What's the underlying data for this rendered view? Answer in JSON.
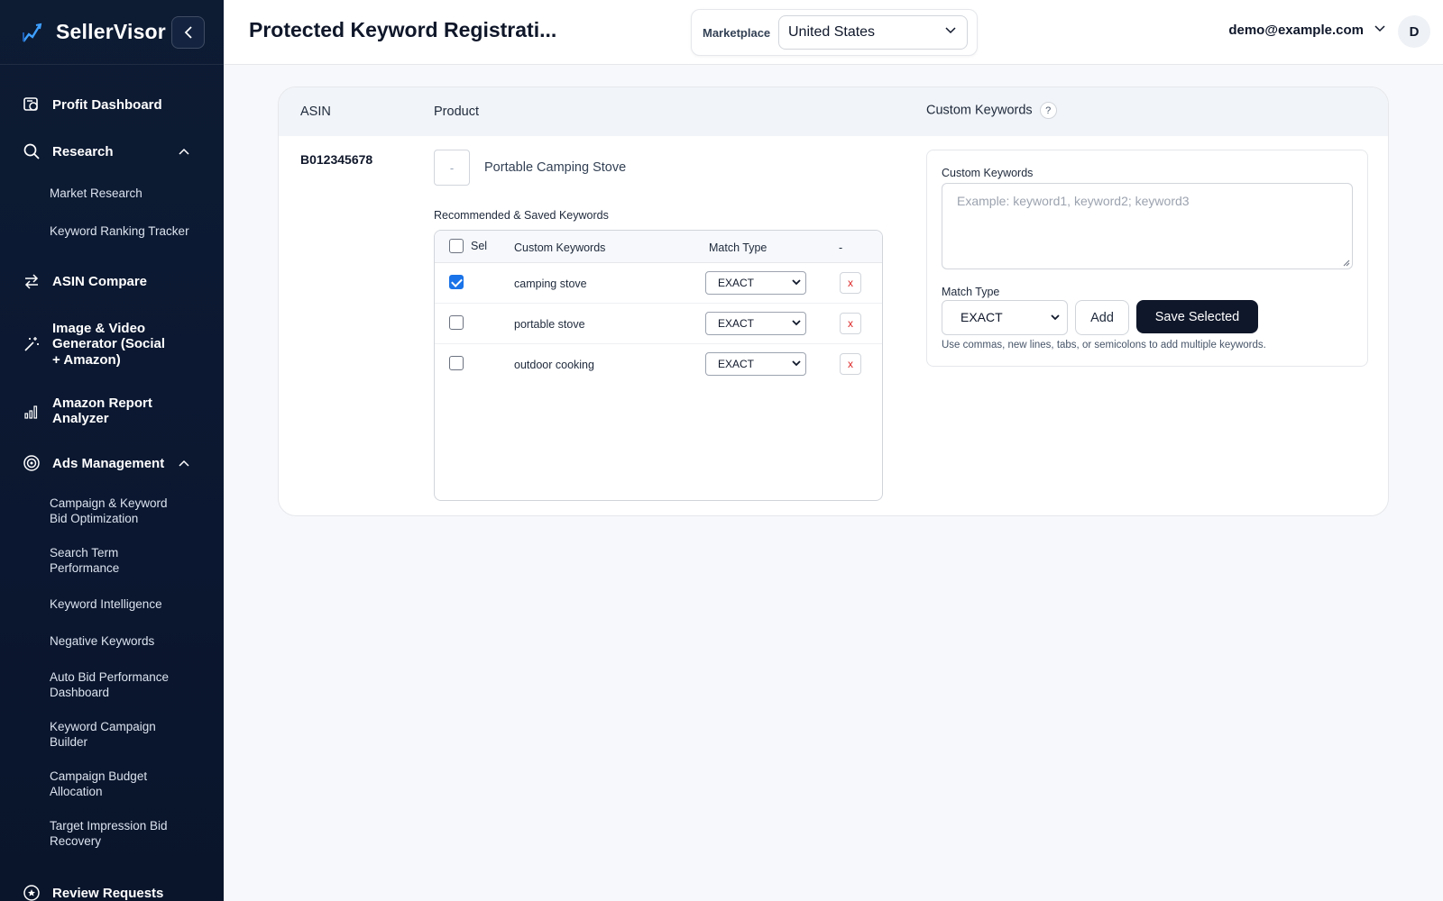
{
  "app": {
    "brand": "SellerVisor"
  },
  "sidebar": {
    "items": [
      {
        "label": "Profit Dashboard",
        "icon": "dashboard-icon"
      },
      {
        "label": "Research",
        "icon": "search-icon",
        "expanded": true,
        "children": [
          "Market Research",
          "Keyword Ranking Tracker"
        ]
      },
      {
        "label": "ASIN Compare",
        "icon": "compare-arrows-icon"
      },
      {
        "label": "Image & Video Generator (Social + Amazon)",
        "icon": "magic-wand-icon"
      },
      {
        "label": "Amazon Report Analyzer",
        "icon": "bar-chart-icon"
      },
      {
        "label": "Ads Management",
        "icon": "target-icon",
        "expanded": true,
        "children": [
          "Campaign & Keyword Bid Optimization",
          "Search Term Performance",
          "Keyword Intelligence",
          "Negative Keywords",
          "Auto Bid Performance Dashboard",
          "Keyword Campaign Builder",
          "Campaign Budget Allocation",
          "Target Impression Bid Recovery"
        ]
      },
      {
        "label": "Review Requests",
        "icon": "review-icon"
      }
    ]
  },
  "header": {
    "title": "Protected Keyword Registrati...",
    "marketplace_label": "Marketplace",
    "marketplace_value": "United States",
    "user_email": "demo@example.com",
    "avatar_initial": "D"
  },
  "table": {
    "columns": {
      "asin": "ASIN",
      "product": "Product",
      "custom_keywords": "Custom Keywords",
      "help": "?"
    },
    "row": {
      "asin": "B012345678",
      "thumb_placeholder": "-",
      "product_name": "Portable Camping Stove",
      "rec_label": "Recommended & Saved Keywords",
      "kw_columns": {
        "sel": "Sel",
        "keyword": "Custom Keywords",
        "match": "Match Type",
        "action": "-"
      },
      "keywords": [
        {
          "keyword": "camping stove",
          "match": "EXACT",
          "checked": true,
          "delete": "x"
        },
        {
          "keyword": "portable stove",
          "match": "EXACT",
          "checked": false,
          "delete": "x"
        },
        {
          "keyword": "outdoor cooking",
          "match": "EXACT",
          "checked": false,
          "delete": "x"
        }
      ]
    }
  },
  "custom_panel": {
    "label": "Custom Keywords",
    "placeholder": "Example: keyword1, keyword2; keyword3",
    "match_label": "Match Type",
    "match_value": "EXACT",
    "add_label": "Add",
    "save_label": "Save Selected",
    "hint": "Use commas, new lines, tabs, or semicolons to add multiple keywords."
  },
  "colors": {
    "sidebar_bg": "#0d1b33",
    "primary_button": "#0f172a",
    "checkbox_accent": "#1a73e8",
    "delete_x": "#dc2626"
  }
}
